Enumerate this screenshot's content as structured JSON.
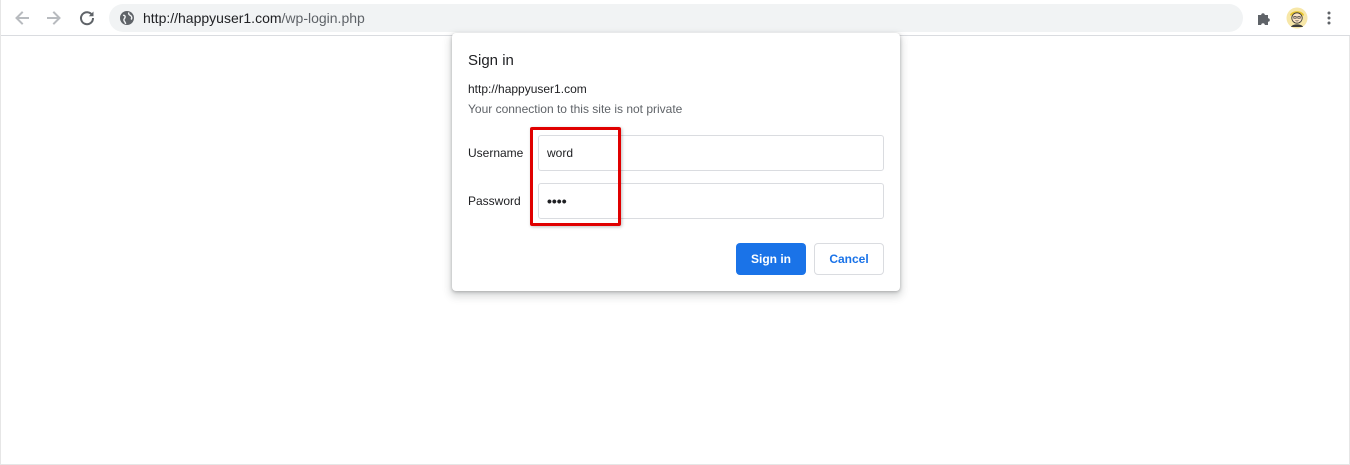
{
  "browser": {
    "url_host": "http://happyuser1.com",
    "url_path": "/wp-login.php",
    "icons": {
      "back": "back-arrow-icon",
      "forward": "forward-arrow-icon",
      "reload": "reload-icon",
      "site_info": "globe-icon",
      "extensions": "puzzle-icon",
      "profile": "avatar-icon",
      "menu": "kebab-menu-icon"
    }
  },
  "dialog": {
    "title": "Sign in",
    "origin": "http://happyuser1.com",
    "warning": "Your connection to this site is not private",
    "username_label": "Username",
    "username_value": "word",
    "password_label": "Password",
    "password_value": "••••",
    "sign_in_label": "Sign in",
    "cancel_label": "Cancel"
  },
  "colors": {
    "accent": "#1a73e8",
    "highlight": "#e00000"
  }
}
